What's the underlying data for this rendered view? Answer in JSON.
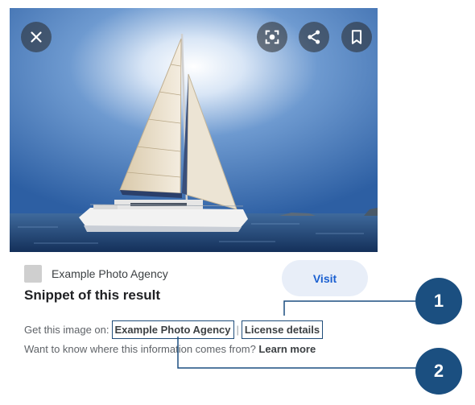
{
  "image_viewer": {
    "close_icon": "close-icon",
    "lens_icon": "lens-icon",
    "share_icon": "share-icon",
    "save_icon": "bookmark-icon"
  },
  "result": {
    "source_name": "Example Photo Agency",
    "title": "Snippet of this result",
    "visit_label": "Visit",
    "get_image_prefix": "Get this image on:",
    "get_image_link": "Example Photo Agency",
    "separator": "|",
    "license_link": "License details",
    "learn_prefix": "Want to know where this information comes from?",
    "learn_link": "Learn more"
  },
  "callouts": {
    "first": "1",
    "second": "2"
  },
  "colors": {
    "callout": "#1b4f80",
    "visit_bg": "#e8eef8",
    "visit_text": "#1a5fd0"
  }
}
